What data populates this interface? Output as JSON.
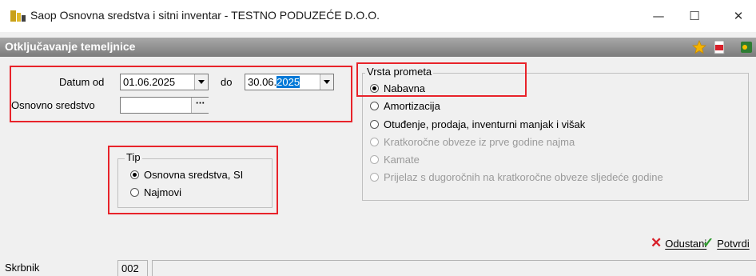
{
  "window": {
    "title": "Saop Osnovna sredstva i sitni inventar - TESTNO PODUZEĆE D.O.O.",
    "minimize_glyph": "—",
    "maximize_glyph": "☐",
    "close_glyph": "✕"
  },
  "header": {
    "title": "Otključavanje temeljnice",
    "icons": [
      "star-icon",
      "pdf-icon",
      "exit-icon"
    ]
  },
  "form": {
    "datum_od_label": "Datum od",
    "datum_od_value": "01.06.2025",
    "do_label": "do",
    "datum_do_prefix": "30.06.",
    "datum_do_selected": "2025",
    "osnovno_sredstvo_label": "Osnovno sredstvo",
    "osnovno_sredstvo_value": "",
    "dots_label": "···"
  },
  "tip": {
    "title": "Tip",
    "options": [
      {
        "label": "Osnovna sredstva, SI",
        "selected": true
      },
      {
        "label": "Najmovi",
        "selected": false
      }
    ]
  },
  "vrsta_prometa": {
    "title": "Vrsta prometa",
    "options": [
      {
        "label": "Nabavna",
        "selected": true,
        "enabled": true
      },
      {
        "label": "Amortizacija",
        "selected": false,
        "enabled": true
      },
      {
        "label": "Otuđenje, prodaja, inventurni manjak i višak",
        "selected": false,
        "enabled": true
      },
      {
        "label": "Kratkoročne obveze iz prve godine najma",
        "selected": false,
        "enabled": false
      },
      {
        "label": "Kamate",
        "selected": false,
        "enabled": false
      },
      {
        "label": "Prijelaz s dugoročnih na kratkoročne obveze sljedeće godine",
        "selected": false,
        "enabled": false
      }
    ]
  },
  "actions": {
    "cancel_label": "Odustani",
    "confirm_label": "Potvrdi",
    "cancel_icon": "cancel-x-icon",
    "confirm_icon": "checkmark-icon"
  },
  "status": {
    "label": "Skrbnik",
    "value": "002"
  },
  "colors": {
    "header_gradient_top": "#a8a8a8",
    "header_gradient_bottom": "#7c7c7c",
    "highlight_box": "#e8232a",
    "selection": "#0078d7",
    "cancel_red": "#d8202a",
    "confirm_green": "#2e9a2e"
  }
}
